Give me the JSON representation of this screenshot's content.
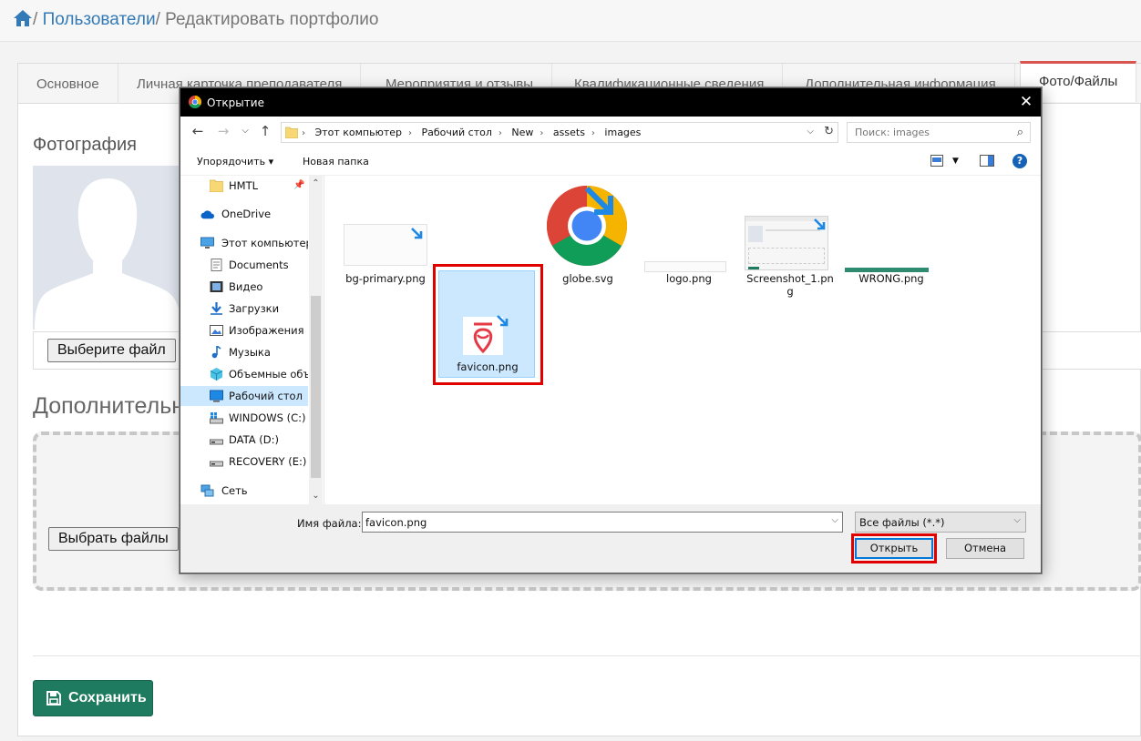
{
  "breadcrumb": {
    "users": "Пользователи",
    "separator": "/",
    "current": "Редактировать портфолио"
  },
  "tabs": [
    "Основное",
    "Личная карточка преподавателя",
    "Мероприятия и отзывы",
    "Квалификационные сведения",
    "Дополнительная информация",
    "Фото/Файлы"
  ],
  "page": {
    "photo_title": "Фотография",
    "choose_file_button": "Выберите файл",
    "extra_title": "Дополнительны",
    "choose_files_button": "Выбрать файлы",
    "save_button": "Сохранить"
  },
  "dialog": {
    "title": "Открытие",
    "close": "✕",
    "path": [
      "Этот компьютер",
      "Рабочий стол",
      "New",
      "assets",
      "images"
    ],
    "search_placeholder": "Поиск: images",
    "organize": "Упорядочить ▾",
    "new_folder": "Новая папка",
    "help": "?",
    "nav_items": [
      {
        "label": "HMTL",
        "icon": "folder-icon"
      },
      {
        "label": "OneDrive",
        "icon": "cloud-icon"
      },
      {
        "label": "Этот компьютер",
        "icon": "computer-icon"
      },
      {
        "label": "Documents",
        "icon": "document-icon"
      },
      {
        "label": "Видео",
        "icon": "video-icon"
      },
      {
        "label": "Загрузки",
        "icon": "download-icon"
      },
      {
        "label": "Изображения",
        "icon": "pictures-icon"
      },
      {
        "label": "Музыка",
        "icon": "music-icon"
      },
      {
        "label": "Объемные объ",
        "icon": "3d-objects-icon"
      },
      {
        "label": "Рабочий стол",
        "icon": "desktop-icon"
      },
      {
        "label": "WINDOWS (C:)",
        "icon": "drive-icon"
      },
      {
        "label": "DATA (D:)",
        "icon": "drive-icon"
      },
      {
        "label": "RECOVERY (E:)",
        "icon": "drive-icon"
      },
      {
        "label": "Сеть",
        "icon": "network-icon"
      }
    ],
    "files": [
      {
        "name": "bg-primary.png"
      },
      {
        "name": "favicon.png"
      },
      {
        "name": "globe.svg"
      },
      {
        "name": "logo.png"
      },
      {
        "name": "Screenshot_1.png"
      },
      {
        "name": "WRONG.png"
      }
    ],
    "filename_label": "Имя файла:",
    "filename_value": "favicon.png",
    "filter_value": "Все файлы (*.*)",
    "open_button": "Открыть",
    "cancel_button": "Отмена"
  },
  "colors": {
    "accent": "#d9534f",
    "save": "#1e7b5f",
    "selection": "#cce8ff",
    "highlight": "#e00000",
    "link": "#337ab7"
  }
}
